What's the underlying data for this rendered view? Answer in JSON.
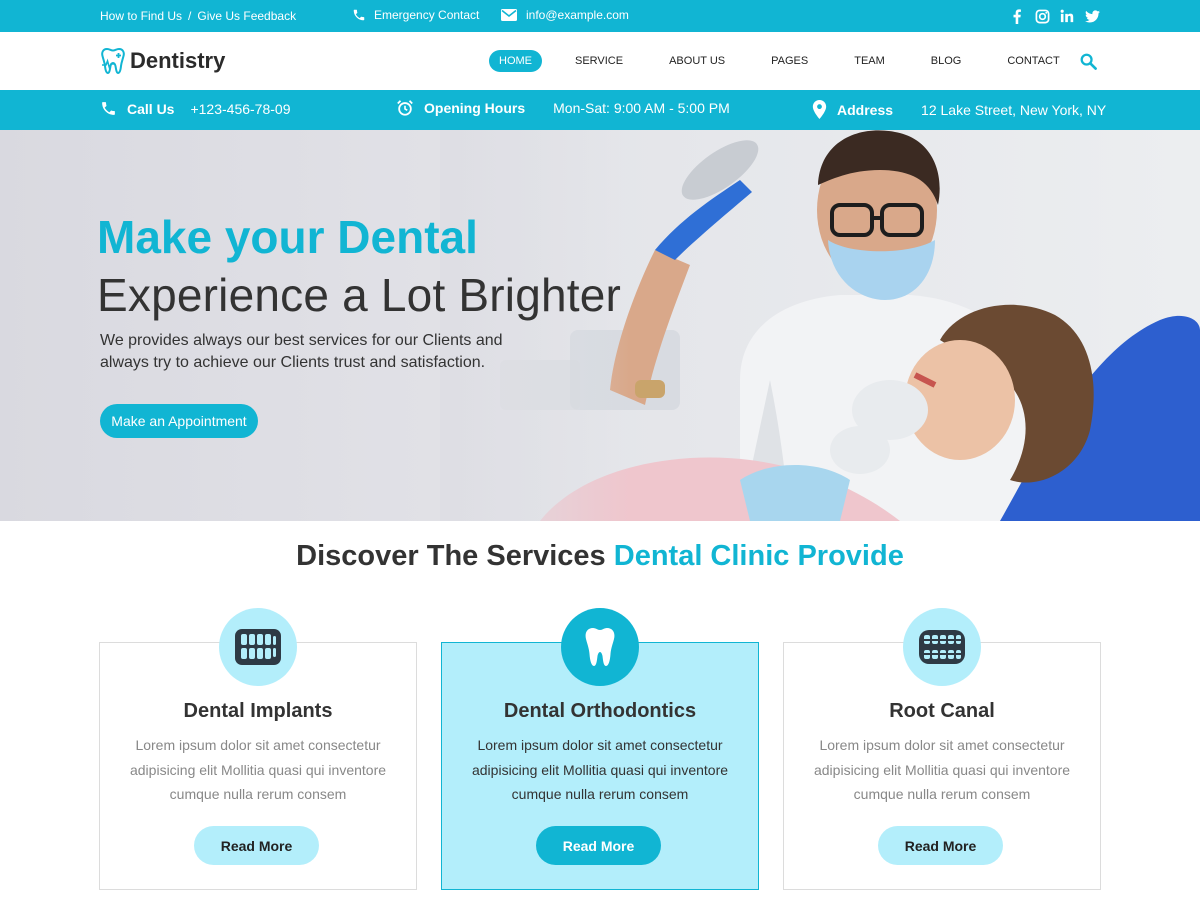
{
  "topbar": {
    "find_us": "How to Find Us",
    "separator": "/",
    "feedback": "Give Us Feedback",
    "emergency": "Emergency Contact",
    "email": "info@example.com",
    "social_icons": [
      "facebook-icon",
      "instagram-icon",
      "linkedin-icon",
      "twitter-icon"
    ]
  },
  "nav": {
    "brand": "Dentistry",
    "items": [
      "HOME",
      "SERVICE",
      "ABOUT US",
      "PAGES",
      "TEAM",
      "BLOG",
      "CONTACT"
    ],
    "active": "HOME"
  },
  "infobar": {
    "call_label": "Call Us",
    "call_value": "+123-456-78-09",
    "hours_label": "Opening Hours",
    "hours_value": "Mon-Sat: 9:00 AM - 5:00 PM",
    "address_label": "Address",
    "address_value": "12 Lake Street, New York, NY"
  },
  "hero": {
    "title_line1": "Make your Dental",
    "title_line2": "Experience a Lot Brighter",
    "paragraph": "We provides always our best services for our Clients and always try to achieve our Clients trust and satisfaction.",
    "cta": "Make an Appointment"
  },
  "services": {
    "heading_plain": "Discover The Services ",
    "heading_highlight": "Dental Clinic Provide",
    "cards": [
      {
        "title": "Dental Implants",
        "desc": "Lorem ipsum dolor sit amet consectetur adipisicing elit Mollitia quasi qui inventore cumque nulla rerum consem",
        "button": "Read More",
        "icon": "teeth-implant-icon"
      },
      {
        "title": "Dental Orthodontics",
        "desc": "Lorem ipsum dolor sit amet consectetur adipisicing elit Mollitia quasi qui inventore cumque nulla rerum consem",
        "button": "Read More",
        "icon": "tooth-icon"
      },
      {
        "title": "Root Canal",
        "desc": "Lorem ipsum dolor sit amet consectetur adipisicing elit Mollitia quasi qui inventore cumque nulla rerum consem",
        "button": "Read More",
        "icon": "braces-icon"
      }
    ]
  },
  "colors": {
    "accent": "#11b5d3",
    "accent_light": "#b3eefb",
    "text_dark": "#333333",
    "text_muted": "#888888"
  }
}
